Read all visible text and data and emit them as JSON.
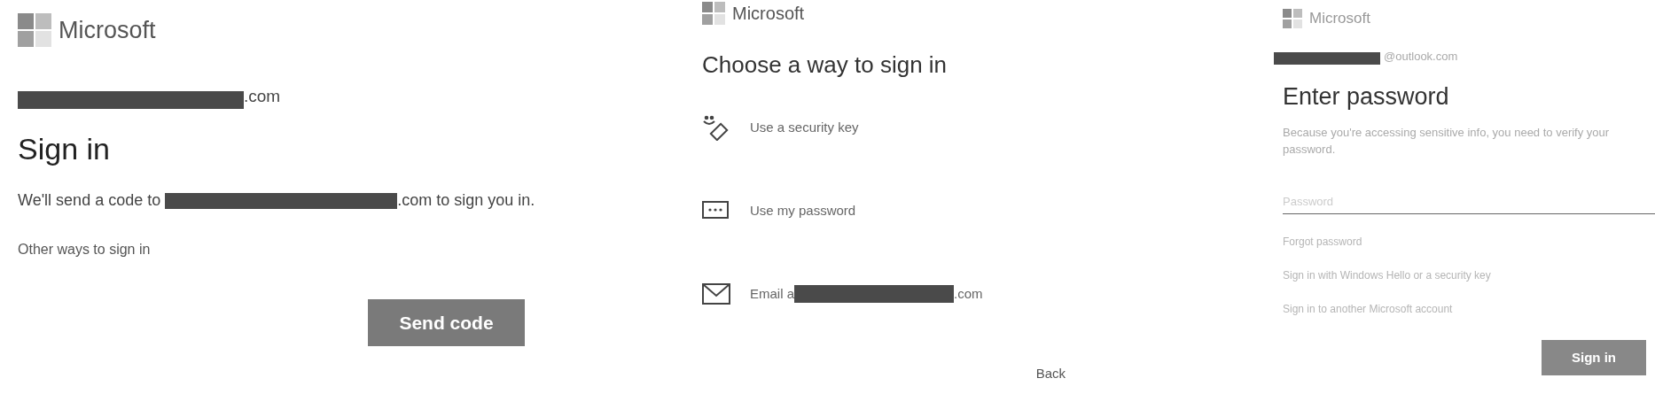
{
  "panels": [
    {
      "kind": "send_code",
      "brand": "Microsoft",
      "email": ".com",
      "title": "Sign in",
      "message_before": "We'll send a code to ",
      "message_after": ".com to sign you in.",
      "link": "Other ways to sign in",
      "button": "Send code"
    },
    {
      "kind": "choose",
      "brand": "Microsoft",
      "title": "Choose a way to sign in",
      "options": [
        {
          "kind": "key",
          "label": "Use a security key"
        },
        {
          "kind": "password",
          "label": "Use my password"
        },
        {
          "kind": "email",
          "label_before": "Email a",
          "label_after": ".com"
        }
      ],
      "back": "Back"
    },
    {
      "kind": "password",
      "brand": "Microsoft",
      "email": "@outlook.com",
      "title": "Enter password",
      "message": "Because you're accessing sensitive info, you need to verify your password.",
      "placeholder": "Password",
      "links": [
        "Forgot password",
        "Sign in with Windows Hello or a security key",
        "Sign in to another Microsoft account"
      ],
      "button": "Sign in"
    }
  ]
}
